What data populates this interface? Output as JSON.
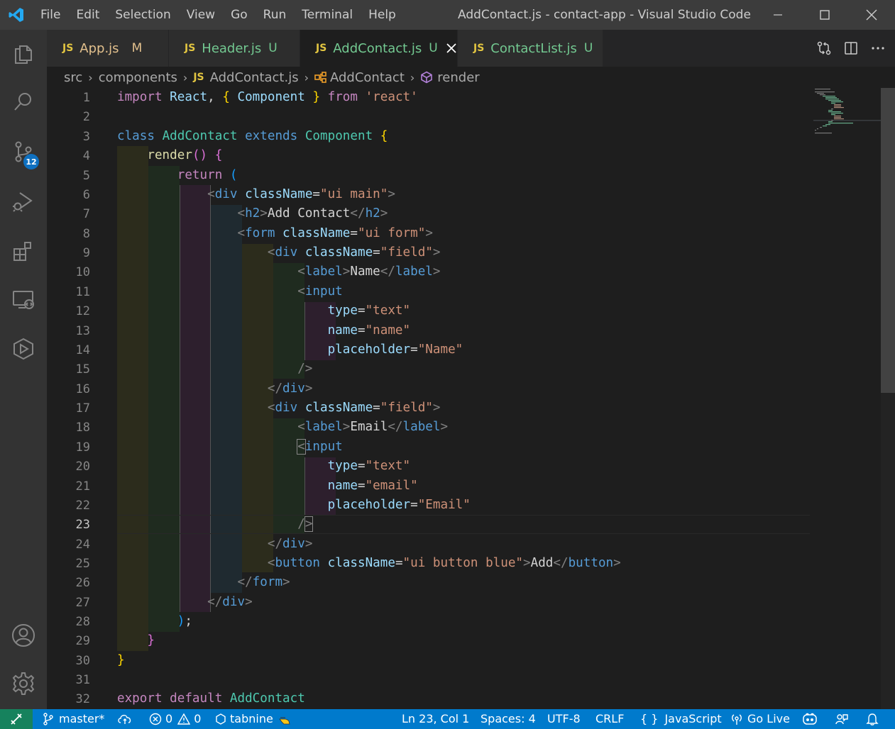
{
  "window": {
    "title": "AddContact.js - contact-app - Visual Studio Code",
    "menu": [
      "File",
      "Edit",
      "Selection",
      "View",
      "Go",
      "Run",
      "Terminal",
      "Help"
    ]
  },
  "activity": {
    "source_control_badge": "12"
  },
  "tabs": [
    {
      "icon": "JS",
      "label": "App.js",
      "status": "M",
      "active": false
    },
    {
      "icon": "JS",
      "label": "Header.js",
      "status": "U",
      "active": false
    },
    {
      "icon": "JS",
      "label": "AddContact.js",
      "status": "U",
      "active": true
    },
    {
      "icon": "JS",
      "label": "ContactList.js",
      "status": "U",
      "active": false
    }
  ],
  "breadcrumb": {
    "folder1": "src",
    "folder2": "components",
    "file_icon": "JS",
    "file": "AddContact.js",
    "class": "AddContact",
    "method": "render"
  },
  "editor": {
    "line_numbers": [
      "1",
      "2",
      "3",
      "4",
      "5",
      "6",
      "7",
      "8",
      "9",
      "10",
      "11",
      "12",
      "13",
      "14",
      "15",
      "16",
      "17",
      "18",
      "19",
      "20",
      "21",
      "22",
      "23",
      "24",
      "25",
      "26",
      "27",
      "28",
      "29",
      "30",
      "31",
      "32"
    ],
    "current_line": 23
  },
  "status": {
    "branch": "master*",
    "errors": "0",
    "warnings": "0",
    "tabnine": "tabnine",
    "position": "Ln 23, Col 1",
    "spaces": "Spaces: 4",
    "encoding": "UTF-8",
    "eol": "CRLF",
    "language_icon": "{ }",
    "language": "JavaScript",
    "golive": "Go Live"
  }
}
